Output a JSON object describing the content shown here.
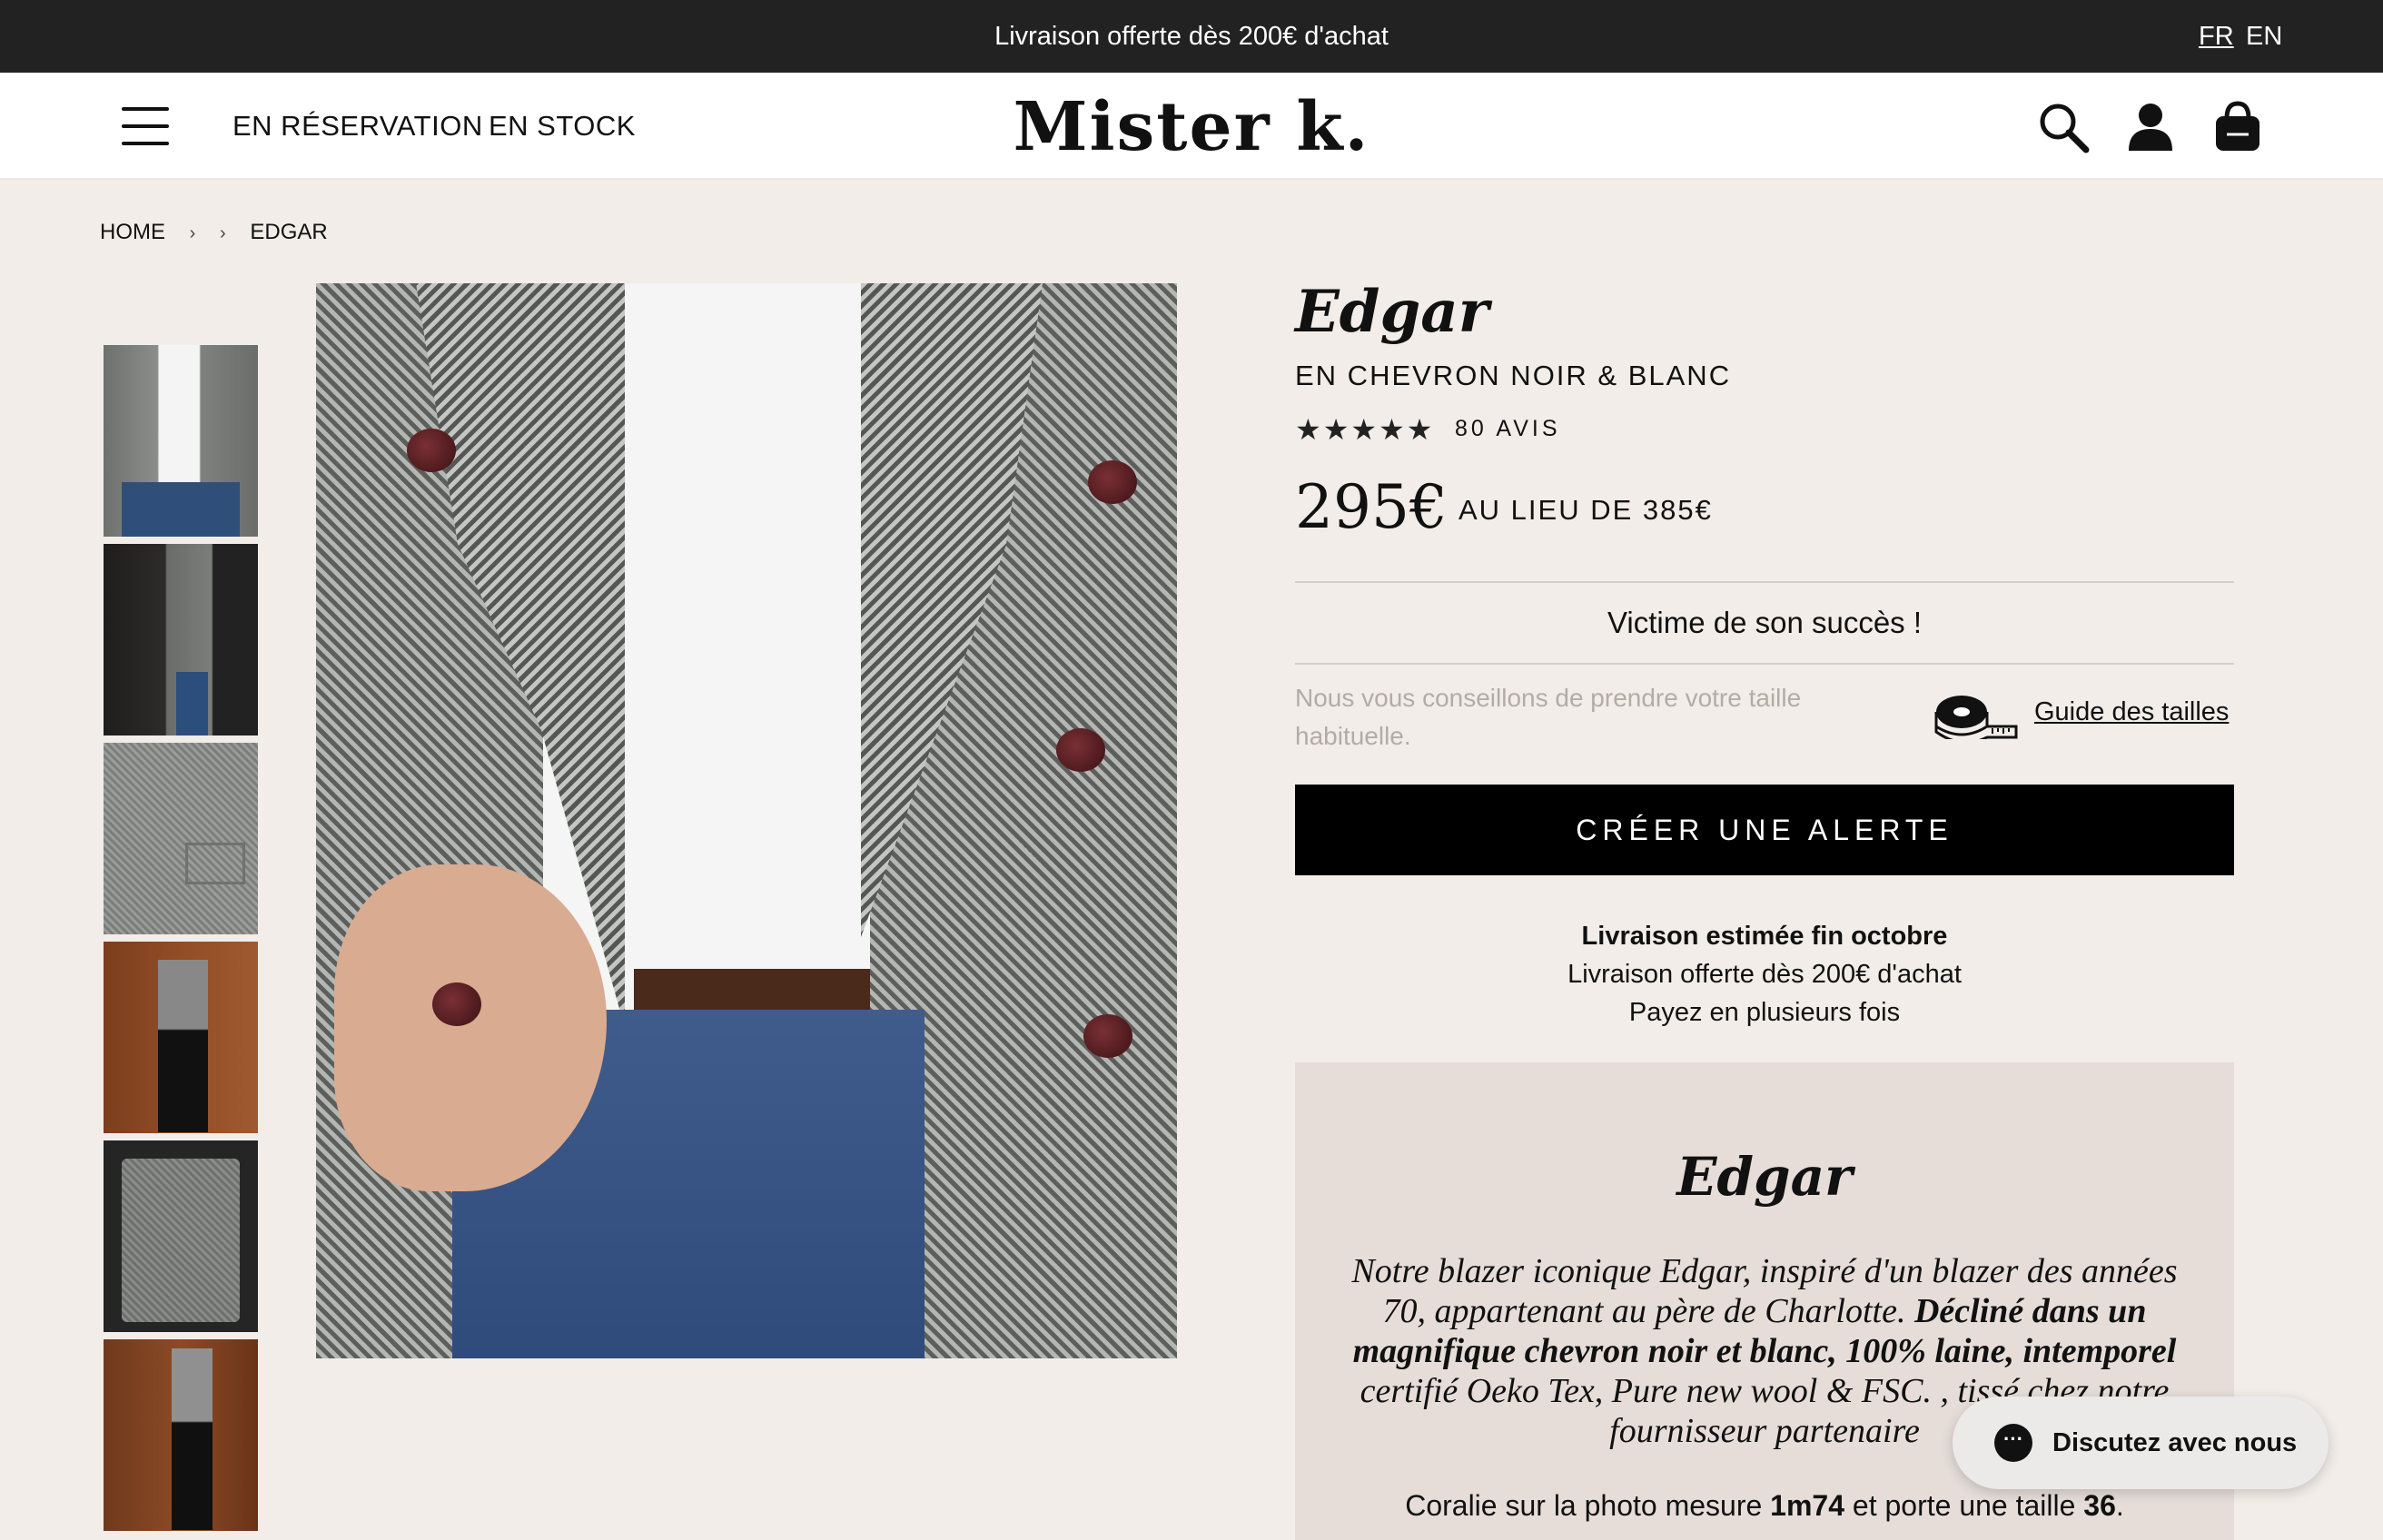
{
  "announcement": {
    "text": "Livraison offerte dès 200€ d'achat",
    "languages": [
      "FR",
      "EN"
    ]
  },
  "header": {
    "nav": [
      "EN RÉSERVATION",
      "EN STOCK"
    ],
    "logo": "Mister k.",
    "icons": [
      "menu-icon",
      "search-icon",
      "account-icon",
      "bag-icon"
    ]
  },
  "breadcrumb": {
    "home": "HOME",
    "separator": "›",
    "current": "EDGAR"
  },
  "product": {
    "title": "Edgar",
    "subtitle": "EN CHEVRON NOIR & BLANC",
    "stars": "★★★★★",
    "rating": 5,
    "reviews": "80 AVIS",
    "price": "295€",
    "old_price": "AU LIEU DE 385€",
    "status": "Victime de son succès !",
    "size_advice": "Nous vous conseillons de prendre votre taille habituelle.",
    "size_guide": "Guide des tailles",
    "cta": "CRÉER UNE ALERTE",
    "shipping": {
      "estimate": "Livraison estimée fin octobre",
      "free": "Livraison offerte dès 200€ d'achat",
      "payment": "Payez en plusieurs fois"
    }
  },
  "description": {
    "title": "Edgar",
    "intro": "Notre blazer iconique Edgar, inspiré d'un blazer des années 70, appartenant au père de Charlotte. ",
    "bold": "Décliné dans un magnifique chevron noir et blanc, 100% laine, intemporel",
    "outro": " certifié Oeko Tex, Pure new wool & FSC. , tissé chez notre fournisseur partenaire",
    "measure_prefix": "Coralie sur la photo mesure ",
    "measure_height": "1m74",
    "measure_mid": " et porte une taille ",
    "measure_size": "36",
    "measure_suffix": "."
  },
  "chat": {
    "label": "Discutez avec nous",
    "bubble": "···"
  },
  "colors": {
    "topbar": "#222222",
    "background": "#f2ede8",
    "card": "#e6ddd9",
    "cta": "#000000"
  }
}
